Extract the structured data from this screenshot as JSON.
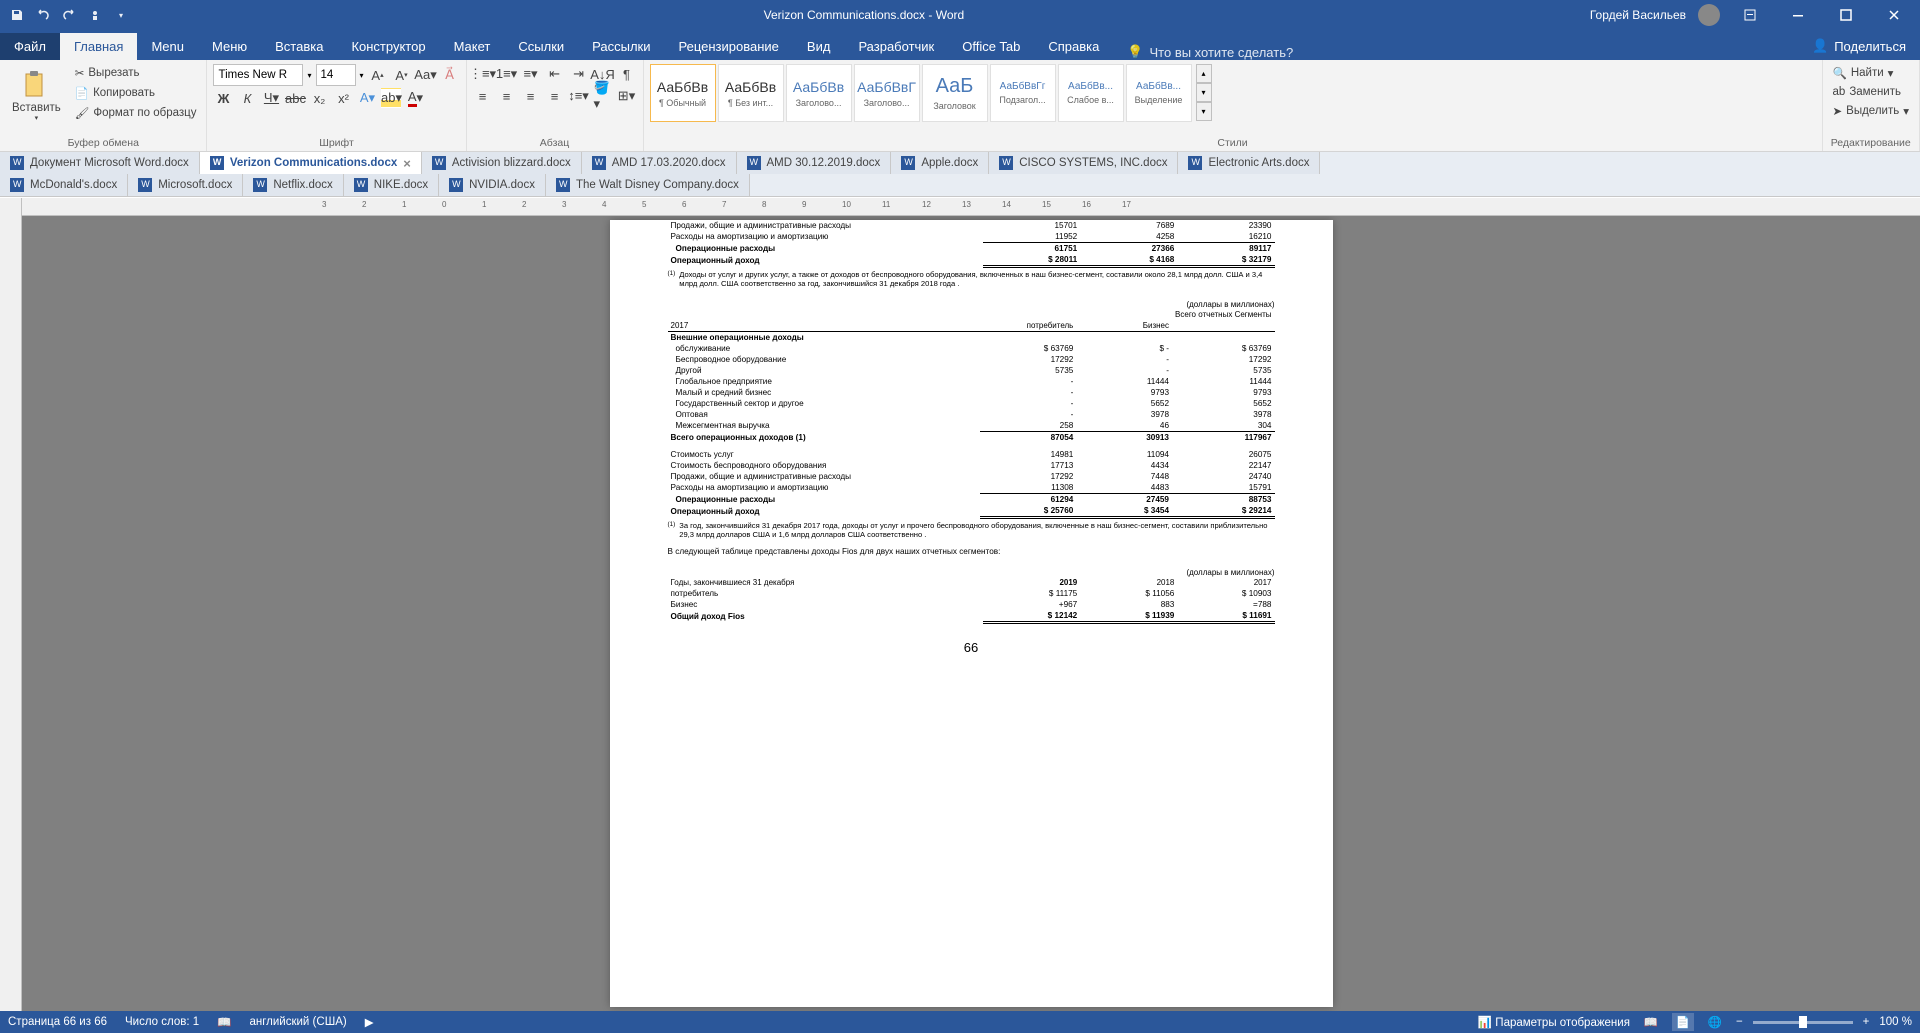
{
  "titlebar": {
    "title": "Verizon Communications.docx - Word",
    "user": "Гордей Васильев"
  },
  "ribbonTabs": [
    "Файл",
    "Главная",
    "Menu",
    "Меню",
    "Вставка",
    "Конструктор",
    "Макет",
    "Ссылки",
    "Рассылки",
    "Рецензирование",
    "Вид",
    "Разработчик",
    "Office Tab",
    "Справка"
  ],
  "tellMe": "Что вы хотите сделать?",
  "share": "Поделиться",
  "clipboard": {
    "paste": "Вставить",
    "cut": "Вырезать",
    "copy": "Копировать",
    "fmt": "Формат по образцу",
    "group": "Буфер обмена"
  },
  "font": {
    "name": "Times New R",
    "size": "14",
    "group": "Шрифт"
  },
  "para": {
    "group": "Абзац"
  },
  "styles": {
    "group": "Стили",
    "items": [
      {
        "preview": "АаБбВв",
        "name": "¶ Обычный"
      },
      {
        "preview": "АаБбВв",
        "name": "¶ Без инт..."
      },
      {
        "preview": "АаБбВв",
        "name": "Заголово..."
      },
      {
        "preview": "АаБбВвГ",
        "name": "Заголово..."
      },
      {
        "preview": "АаБ",
        "name": "Заголовок"
      },
      {
        "preview": "АаБбВвГг",
        "name": "Подзагол..."
      },
      {
        "preview": "АаБбВв...",
        "name": "Слабое в..."
      },
      {
        "preview": "АаБбВв...",
        "name": "Выделение"
      }
    ]
  },
  "editing": {
    "find": "Найти",
    "replace": "Заменить",
    "select": "Выделить",
    "group": "Редактирование"
  },
  "doctabs": {
    "row1": [
      "Документ Microsoft Word.docx",
      "Verizon Communications.docx",
      "Activision blizzard.docx",
      "AMD 17.03.2020.docx",
      "AMD 30.12.2019.docx",
      "Apple.docx",
      "CISCO SYSTEMS, INC.docx",
      "Electronic Arts.docx"
    ],
    "row2": [
      "McDonald's.docx",
      "Microsoft.docx",
      "Netflix.docx",
      "NIKE.docx",
      "NVIDIA.docx",
      "The Walt Disney Company.docx"
    ],
    "activeIdx": 1
  },
  "status": {
    "page": "Страница 66 из 66",
    "words": "Число слов: 1",
    "lang": "английский (США)",
    "display": "Параметры отображения",
    "zoom": "100 %"
  },
  "doc": {
    "top": [
      {
        "c": [
          "Продажи, общие и административные расходы",
          "15701",
          "7689",
          "23390"
        ]
      },
      {
        "c": [
          "Расходы на амортизацию и амортизацию",
          "11952",
          "4258",
          "16210"
        ]
      },
      {
        "c": [
          "Операционные расходы",
          "61751",
          "27366",
          "89117"
        ],
        "bold": true,
        "indent": true,
        "topline": true
      },
      {
        "c": [
          "Операционный доход",
          "$        28011",
          "$        4168",
          "$        32179"
        ],
        "bold": true,
        "dbl": true
      }
    ],
    "fn1_sup": "(1)",
    "fn1": "Доходы от услуг и других услуг, а также от доходов от беспроводного оборудования, включенных в наш бизнес-сегмент, составили около 28,1 млрд долл. США и 3,4 млрд долл. США соответственно за год, закончившийся 31 декабря 2018 года .",
    "unit": "(доллары в миллионах)",
    "hdr": {
      "year": "2017",
      "c1": "потребитель",
      "c2": "Бизнес",
      "c3": "Всего отчетных Сегменты"
    },
    "ext_title": "Внешние операционные доходы",
    "ext": [
      {
        "c": [
          "обслуживание",
          "$        63769",
          "$               -",
          "$        63769"
        ]
      },
      {
        "c": [
          "Беспроводное оборудование",
          "17292",
          "-",
          "17292"
        ]
      },
      {
        "c": [
          "Другой",
          "5735",
          "-",
          "5735"
        ]
      },
      {
        "c": [
          "Глобальное предприятие",
          "-",
          "11444",
          "11444"
        ]
      },
      {
        "c": [
          "Малый и средний бизнес",
          "-",
          "9793",
          "9793"
        ]
      },
      {
        "c": [
          "Государственный сектор и другое",
          "-",
          "5652",
          "5652"
        ]
      },
      {
        "c": [
          "Оптовая",
          "-",
          "3978",
          "3978"
        ]
      },
      {
        "c": [
          "Межсегментная выручка",
          "258",
          "46",
          "304"
        ]
      }
    ],
    "tot": {
      "c": [
        "Всего операционных доходов (1)",
        "87054",
        "30913",
        "117967"
      ],
      "bold": true,
      "topline": true
    },
    "ops": [
      {
        "c": [
          "Стоимость услуг",
          "14981",
          "11094",
          "26075"
        ]
      },
      {
        "c": [
          "Стоимость беспроводного оборудования",
          "17713",
          "4434",
          "22147"
        ]
      },
      {
        "c": [
          "Продажи, общие и административные расходы",
          "17292",
          "7448",
          "24740"
        ]
      },
      {
        "c": [
          "Расходы на амортизацию и амортизацию",
          "11308",
          "4483",
          "15791"
        ]
      }
    ],
    "opex": {
      "c": [
        "Операционные расходы",
        "61294",
        "27459",
        "88753"
      ],
      "bold": true,
      "indent": true,
      "topline": true
    },
    "opinc": {
      "c": [
        "Операционный доход",
        "$        25760",
        "$         3454",
        "$        29214"
      ],
      "bold": true,
      "dbl": true
    },
    "fn2_sup": "(1)",
    "fn2": "За год, закончившийся 31 декабря 2017 года, доходы от услуг и прочего беспроводного оборудования, включенные в наш бизнес-сегмент, составили приблизительно 29,3 млрд долларов США и 1,6 млрд долларов США соответственно .",
    "para2": "В следующей таблице представлены доходы Fios для двух наших отчетных сегментов:",
    "unit2": "(доллары в миллионах)",
    "fios_hdr": {
      "label": "Годы, закончившиеся 31 декабря",
      "y1": "2019",
      "y2": "2018",
      "y3": "2017"
    },
    "fios": [
      {
        "c": [
          "потребитель",
          "$        11175",
          "$        11056",
          "$        10903"
        ]
      },
      {
        "c": [
          "Бизнес",
          "+967",
          "883",
          "=788"
        ]
      },
      {
        "c": [
          "Общий доход Fios",
          "$        12142",
          "$        11939",
          "$        11691"
        ],
        "bold": true,
        "dbl": true
      }
    ],
    "pagenum": "66"
  }
}
